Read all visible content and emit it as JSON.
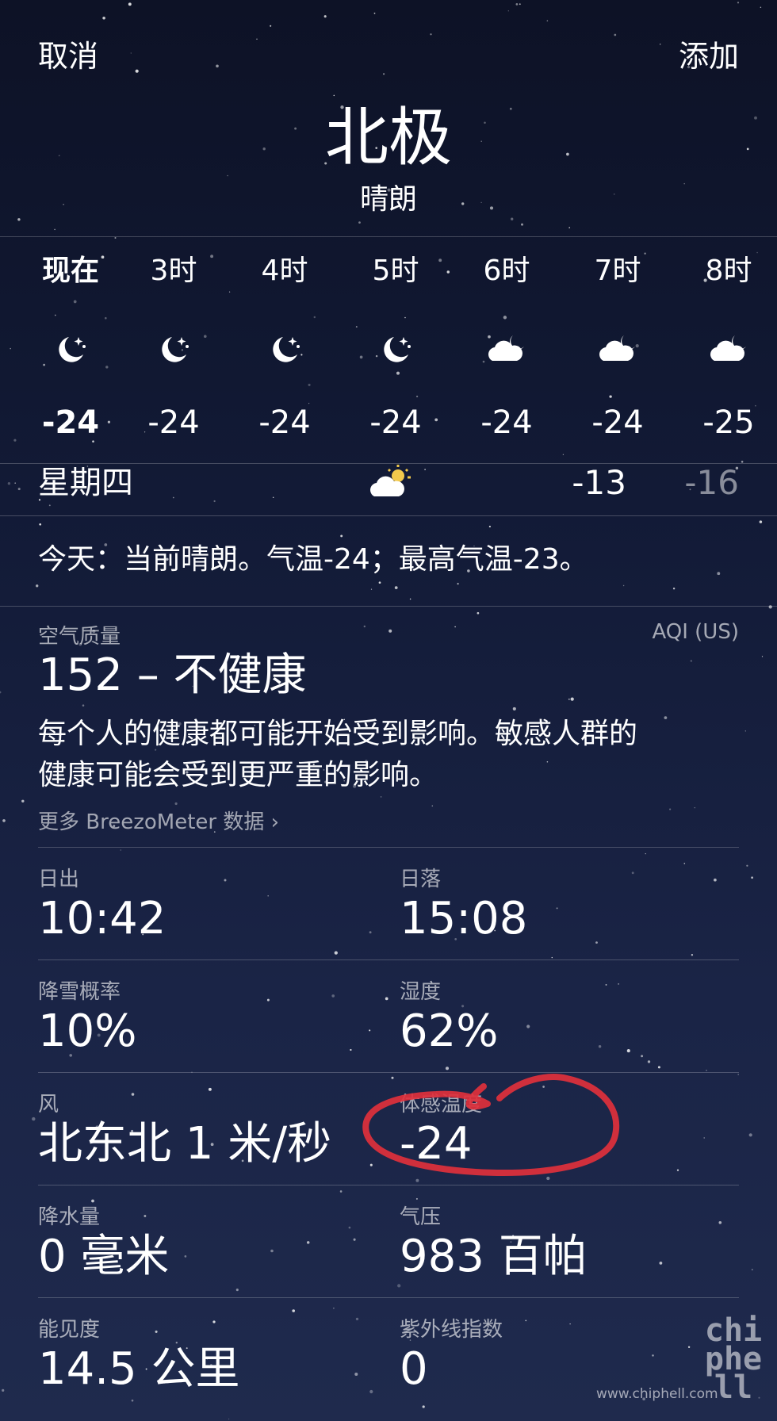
{
  "header": {
    "cancel_label": "取消",
    "add_label": "添加",
    "location": "北极",
    "condition": "晴朗"
  },
  "hourly": [
    {
      "label": "现在",
      "icon": "moon-stars-icon",
      "temp": "-24"
    },
    {
      "label": "3时",
      "icon": "moon-stars-icon",
      "temp": "-24"
    },
    {
      "label": "4时",
      "icon": "moon-stars-icon",
      "temp": "-24"
    },
    {
      "label": "5时",
      "icon": "moon-stars-icon",
      "temp": "-24"
    },
    {
      "label": "6时",
      "icon": "cloudy-night-icon",
      "temp": "-24"
    },
    {
      "label": "7时",
      "icon": "cloudy-night-icon",
      "temp": "-24"
    },
    {
      "label": "8时",
      "icon": "cloudy-night-icon",
      "temp": "-25"
    }
  ],
  "daily": {
    "day": "星期四",
    "icon": "partly-sunny-icon",
    "high": "-13",
    "low": "-16"
  },
  "summary": "今天：当前晴朗。气温-24；最高气温-23。",
  "air_quality": {
    "title": "空气质量",
    "scale": "AQI (US)",
    "value": "152 – 不健康",
    "description_line1": "每个人的健康都可能开始受到影响。敏感人群的",
    "description_line2": "健康可能会受到更严重的影响。",
    "more_link": "更多 BreezoMeter 数据",
    "more_chevron": "›"
  },
  "details": [
    {
      "label": "日出",
      "value": "10:42"
    },
    {
      "label": "日落",
      "value": "15:08"
    },
    {
      "label": "降雪概率",
      "value": "10%"
    },
    {
      "label": "湿度",
      "value": "62%"
    },
    {
      "label": "风",
      "value": "北东北 1 米/秒"
    },
    {
      "label": "体感温度",
      "value": "-24"
    },
    {
      "label": "降水量",
      "value": "0 毫米"
    },
    {
      "label": "气压",
      "value": "983 百帕"
    },
    {
      "label": "能见度",
      "value": "14.5 公里"
    },
    {
      "label": "紫外线指数",
      "value": "0"
    }
  ],
  "watermark": {
    "logo_text": "chiphell",
    "url": "www.chiphell.com"
  },
  "colors": {
    "annotation": "#e0303c",
    "background_top": "#0d1226",
    "background_bottom": "#1f2a4d"
  }
}
